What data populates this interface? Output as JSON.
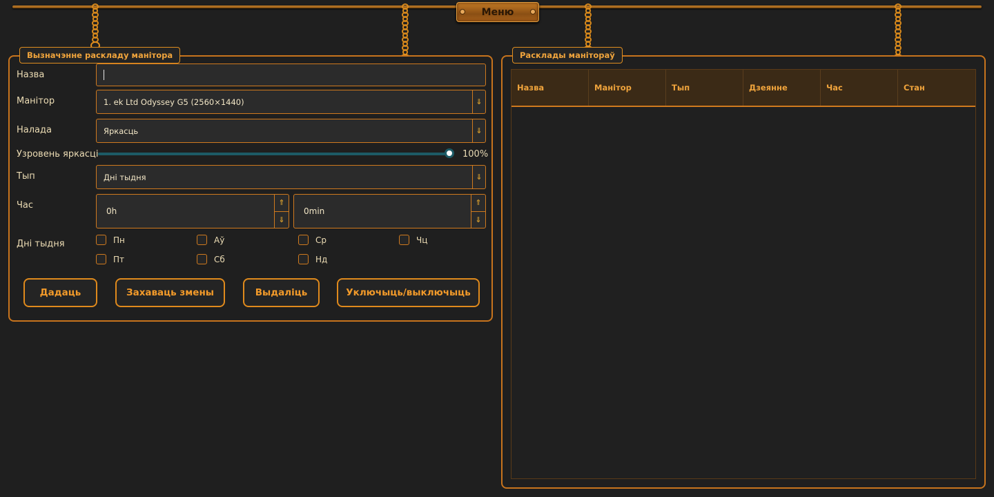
{
  "menu": {
    "label": "Меню"
  },
  "editor": {
    "title": "Вызначэнне раскладу манітора",
    "name": {
      "label": "Назва",
      "value": ""
    },
    "monitor": {
      "label": "Манітор",
      "value": "1. ek Ltd Odyssey G5 (2560×1440)"
    },
    "setting": {
      "label": "Налада",
      "value": "Яркасць"
    },
    "brightness": {
      "label": "Узровень яркасці",
      "value": 100,
      "display": "100%"
    },
    "type": {
      "label": "Тып",
      "value": "Дні тыдня"
    },
    "time": {
      "label": "Час",
      "hours": "0h",
      "minutes": "0min"
    },
    "days": {
      "label": "Дні тыдня",
      "items": [
        {
          "label": "Пн",
          "checked": false
        },
        {
          "label": "Аў",
          "checked": false
        },
        {
          "label": "Ср",
          "checked": false
        },
        {
          "label": "Чц",
          "checked": false
        },
        {
          "label": "Пт",
          "checked": false
        },
        {
          "label": "Сб",
          "checked": false
        },
        {
          "label": "Нд",
          "checked": false
        }
      ]
    },
    "buttons": {
      "add": "Дадаць",
      "save": "Захаваць змены",
      "delete": "Выдаліць",
      "toggle": "Уключыць/выключыць"
    }
  },
  "schedules": {
    "title": "Расклады манітораў",
    "columns": [
      "Назва",
      "Манітор",
      "Тып",
      "Дзеянне",
      "Час",
      "Стан"
    ],
    "rows": []
  },
  "colors": {
    "accent": "#e08a1c",
    "background": "#1f1f1f",
    "slider": "#1d5b66"
  },
  "icons": {
    "dropdown": "⇓",
    "spin_up": "⇑",
    "spin_down": "⇓"
  }
}
